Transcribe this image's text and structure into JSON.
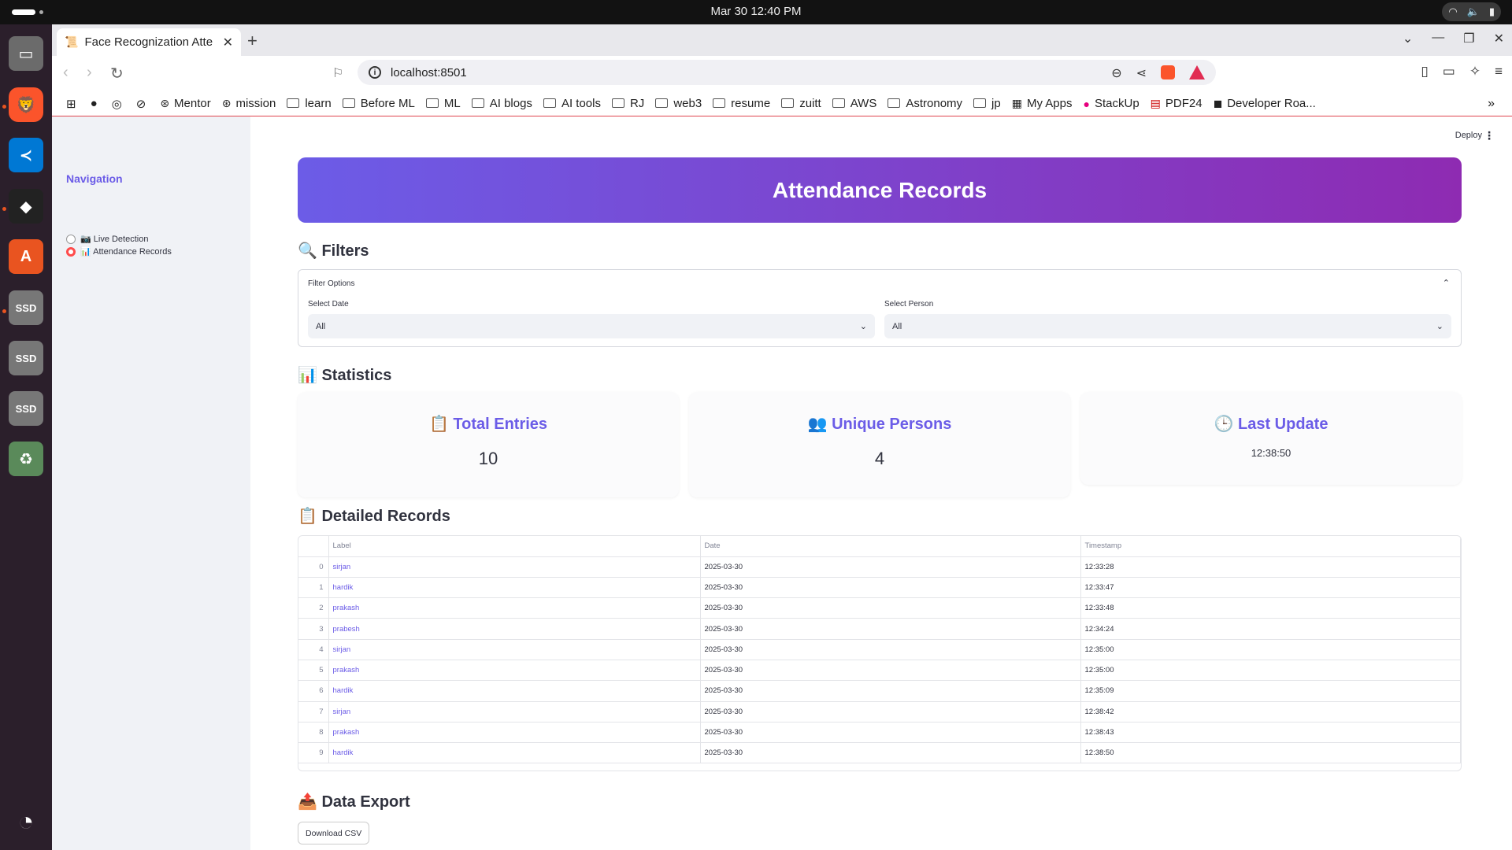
{
  "system": {
    "clock": "Mar 30  12:40 PM"
  },
  "browser": {
    "tab_title": "Face Recognization Atte",
    "url": "localhost:8501",
    "bookmarks": [
      "Mentor",
      "mission",
      "learn",
      "Before ML",
      "ML",
      "AI blogs",
      "AI tools",
      "RJ",
      "web3",
      "resume",
      "zuitt",
      "AWS",
      "Astronomy",
      "jp",
      "My Apps",
      "StackUp",
      "PDF24",
      "Developer Roa..."
    ]
  },
  "sidebar": {
    "title": "Navigation",
    "options": [
      {
        "label": "📷 Live Detection",
        "selected": false
      },
      {
        "label": "📊 Attendance Records",
        "selected": true
      }
    ]
  },
  "header": {
    "deploy": "Deploy"
  },
  "main": {
    "banner_title": "Attendance Records",
    "filters_heading": "🔍 Filters",
    "filter_options_label": "Filter Options",
    "select_date_label": "Select Date",
    "select_date_value": "All",
    "select_person_label": "Select Person",
    "select_person_value": "All",
    "statistics_heading": "📊 Statistics",
    "stats": {
      "total_entries_title": "📋 Total Entries",
      "total_entries_value": "10",
      "unique_persons_title": "👥 Unique Persons",
      "unique_persons_value": "4",
      "last_update_title": "🕒 Last Update",
      "last_update_value": "12:38:50"
    },
    "records_heading": "📋 Detailed Records",
    "table": {
      "columns": [
        "Label",
        "Date",
        "Timestamp"
      ],
      "rows": [
        {
          "idx": "0",
          "label": "sirjan",
          "date": "2025-03-30",
          "time": "12:33:28"
        },
        {
          "idx": "1",
          "label": "hardik",
          "date": "2025-03-30",
          "time": "12:33:47"
        },
        {
          "idx": "2",
          "label": "prakash",
          "date": "2025-03-30",
          "time": "12:33:48"
        },
        {
          "idx": "3",
          "label": "prabesh",
          "date": "2025-03-30",
          "time": "12:34:24"
        },
        {
          "idx": "4",
          "label": "sirjan",
          "date": "2025-03-30",
          "time": "12:35:00"
        },
        {
          "idx": "5",
          "label": "prakash",
          "date": "2025-03-30",
          "time": "12:35:00"
        },
        {
          "idx": "6",
          "label": "hardik",
          "date": "2025-03-30",
          "time": "12:35:09"
        },
        {
          "idx": "7",
          "label": "sirjan",
          "date": "2025-03-30",
          "time": "12:38:42"
        },
        {
          "idx": "8",
          "label": "prakash",
          "date": "2025-03-30",
          "time": "12:38:43"
        },
        {
          "idx": "9",
          "label": "hardik",
          "date": "2025-03-30",
          "time": "12:38:50"
        }
      ]
    },
    "export_heading": "📤 Data Export",
    "download_label": "Download CSV"
  }
}
